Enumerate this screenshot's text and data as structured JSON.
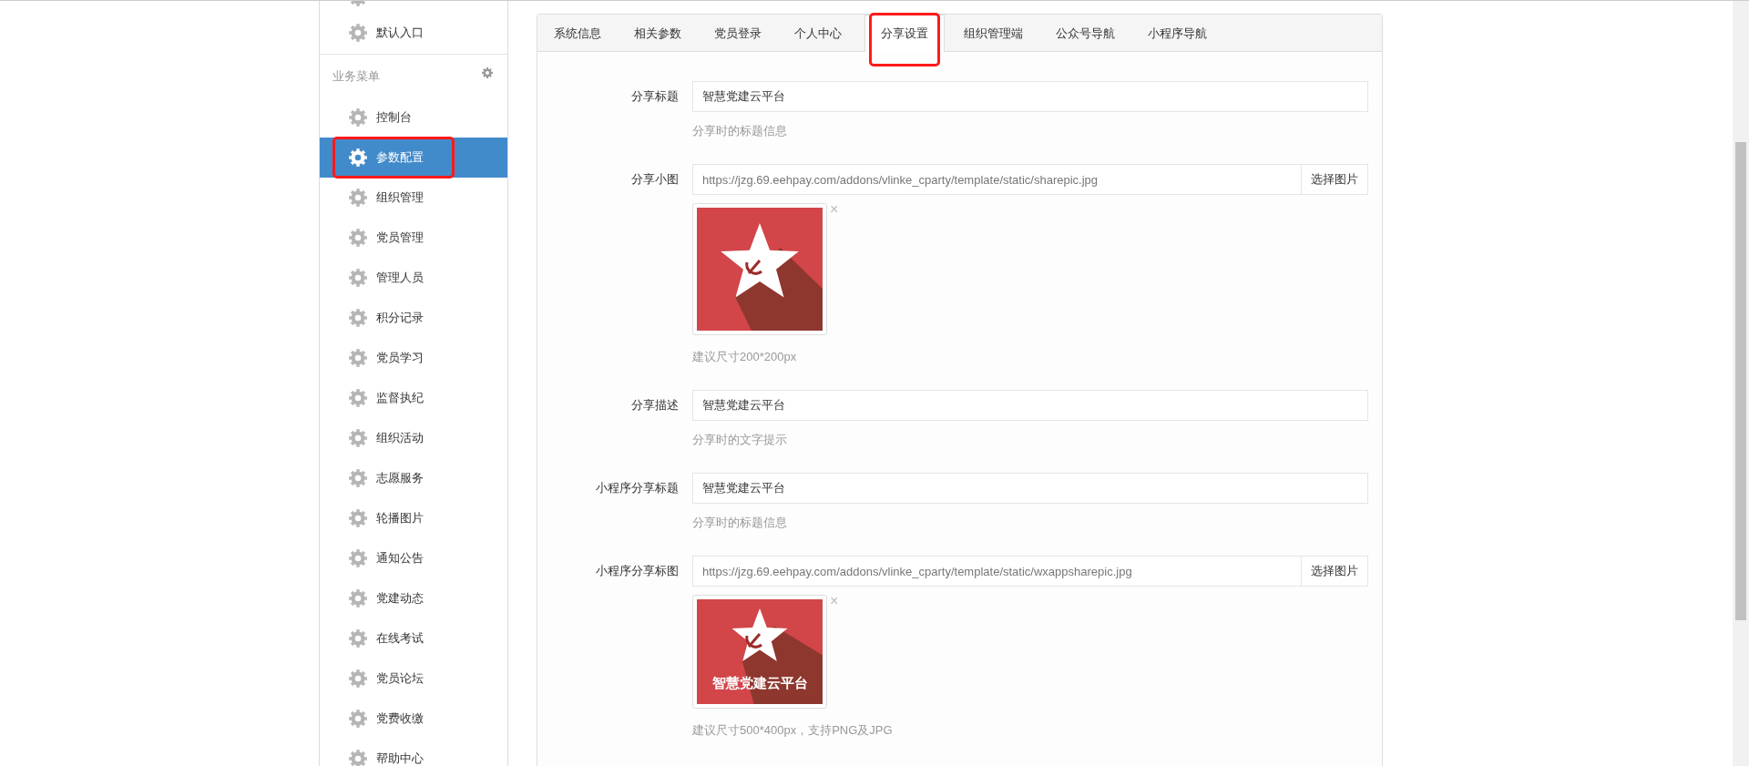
{
  "sidebar": {
    "top_item": {
      "label": "默认入口"
    },
    "section_title": "业务菜单",
    "items": [
      {
        "label": "控制台",
        "selected": false,
        "highlighted": false
      },
      {
        "label": "参数配置",
        "selected": true,
        "highlighted": true
      },
      {
        "label": "组织管理",
        "selected": false,
        "highlighted": false
      },
      {
        "label": "党员管理",
        "selected": false,
        "highlighted": false
      },
      {
        "label": "管理人员",
        "selected": false,
        "highlighted": false
      },
      {
        "label": "积分记录",
        "selected": false,
        "highlighted": false
      },
      {
        "label": "党员学习",
        "selected": false,
        "highlighted": false
      },
      {
        "label": "监督执纪",
        "selected": false,
        "highlighted": false
      },
      {
        "label": "组织活动",
        "selected": false,
        "highlighted": false
      },
      {
        "label": "志愿服务",
        "selected": false,
        "highlighted": false
      },
      {
        "label": "轮播图片",
        "selected": false,
        "highlighted": false
      },
      {
        "label": "通知公告",
        "selected": false,
        "highlighted": false
      },
      {
        "label": "党建动态",
        "selected": false,
        "highlighted": false
      },
      {
        "label": "在线考试",
        "selected": false,
        "highlighted": false
      },
      {
        "label": "党员论坛",
        "selected": false,
        "highlighted": false
      },
      {
        "label": "党费收缴",
        "selected": false,
        "highlighted": false
      },
      {
        "label": "帮助中心",
        "selected": false,
        "highlighted": false
      }
    ]
  },
  "tabs": [
    {
      "label": "系统信息",
      "selected": false,
      "highlighted": false
    },
    {
      "label": "相关参数",
      "selected": false,
      "highlighted": false
    },
    {
      "label": "党员登录",
      "selected": false,
      "highlighted": false
    },
    {
      "label": "个人中心",
      "selected": false,
      "highlighted": false
    },
    {
      "label": "分享设置",
      "selected": true,
      "highlighted": true
    },
    {
      "label": "组织管理端",
      "selected": false,
      "highlighted": false
    },
    {
      "label": "公众号导航",
      "selected": false,
      "highlighted": false
    },
    {
      "label": "小程序导航",
      "selected": false,
      "highlighted": false
    }
  ],
  "form": {
    "rows": [
      {
        "kind": "text",
        "label": "分享标题",
        "value": "智慧党建云平台",
        "help": "分享时的标题信息"
      },
      {
        "kind": "image",
        "label": "分享小图",
        "value": "https://jzg.69.eehpay.com/addons/vlinke_cparty/template/static/sharepic.jpg",
        "button": "选择图片",
        "remove": "×",
        "help": "建议尺寸200*200px"
      },
      {
        "kind": "text",
        "label": "分享描述",
        "value": "智慧党建云平台",
        "help": "分享时的文字提示"
      },
      {
        "kind": "text",
        "label": "小程序分享标题",
        "value": "智慧党建云平台",
        "help": "分享时的标题信息"
      },
      {
        "kind": "image",
        "label": "小程序分享标图",
        "value": "https://jzg.69.eehpay.com/addons/vlinke_cparty/template/static/wxappsharepic.jpg",
        "button": "选择图片",
        "remove": "×",
        "preview_text": "智慧党建云平台",
        "help": "建议尺寸500*400px，支持PNG及JPG"
      }
    ]
  }
}
